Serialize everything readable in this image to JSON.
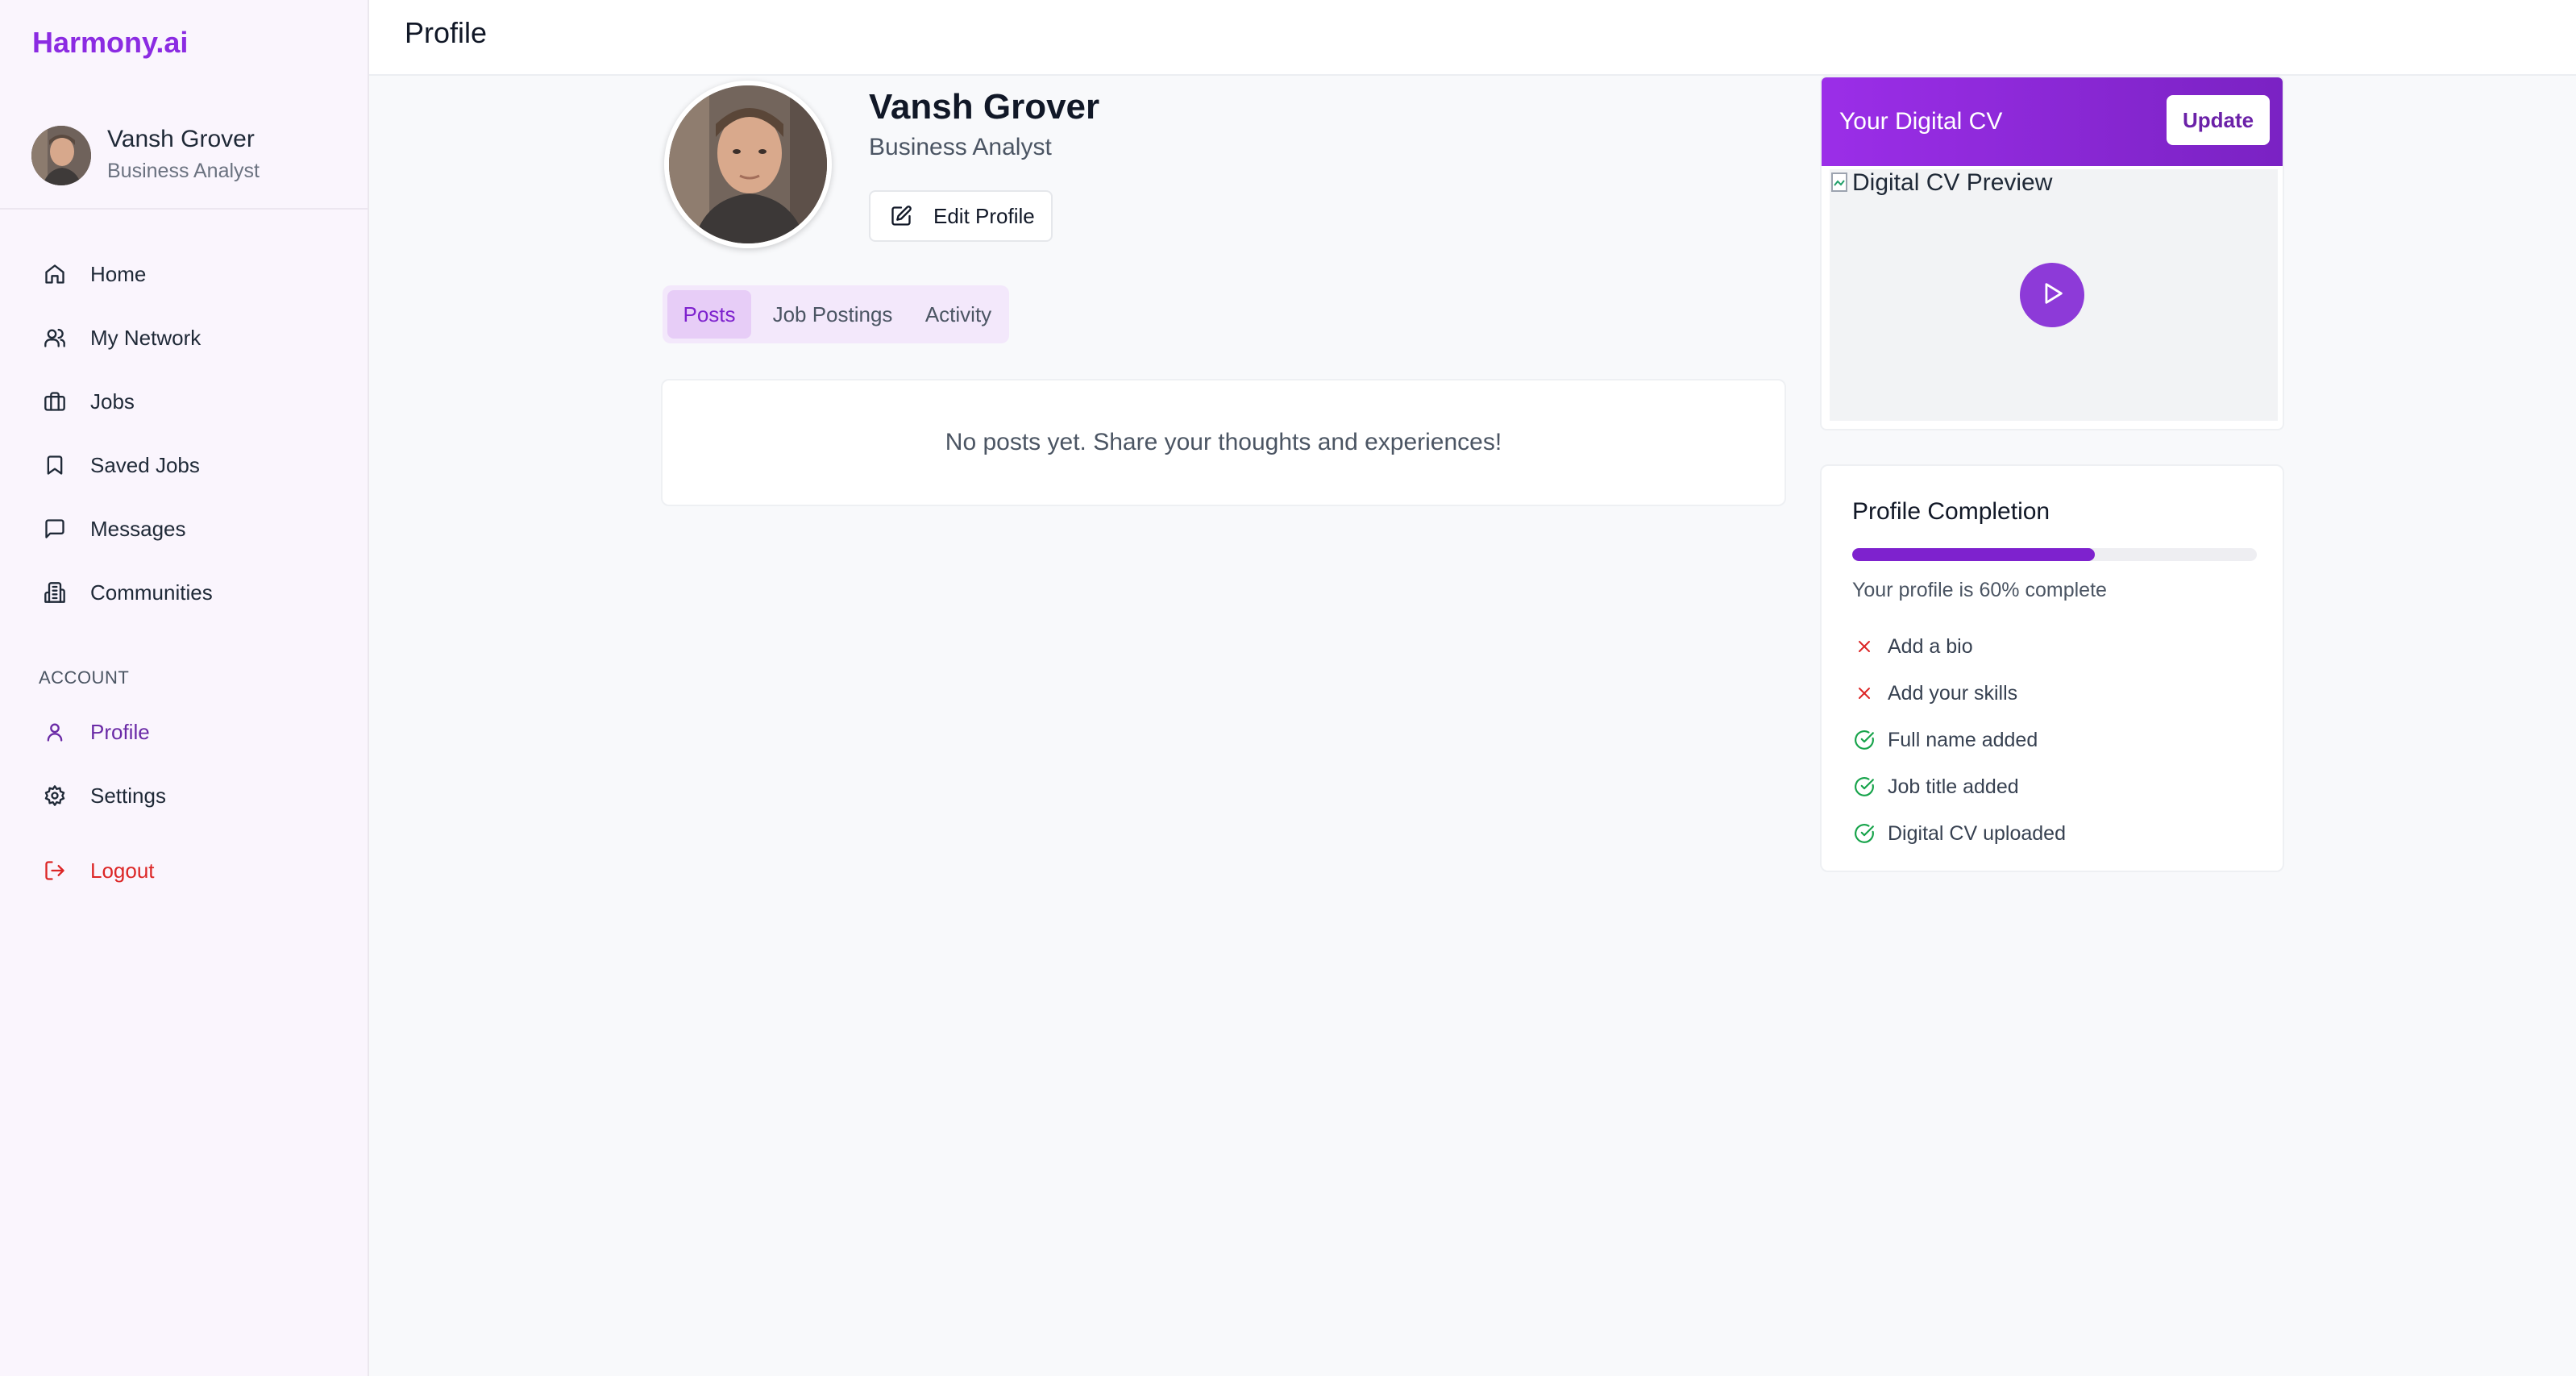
{
  "app": {
    "brand": "Harmony.ai",
    "accent": "#8b2be2"
  },
  "user": {
    "name": "Vansh Grover",
    "title": "Business Analyst"
  },
  "sidebar": {
    "items": [
      {
        "label": "Home",
        "icon": "home-icon"
      },
      {
        "label": "My Network",
        "icon": "users-icon"
      },
      {
        "label": "Jobs",
        "icon": "briefcase-icon"
      },
      {
        "label": "Saved Jobs",
        "icon": "bookmark-icon"
      },
      {
        "label": "Messages",
        "icon": "message-icon"
      },
      {
        "label": "Communities",
        "icon": "building-icon"
      }
    ],
    "section_label": "ACCOUNT",
    "account_items": [
      {
        "label": "Profile",
        "icon": "user-icon",
        "active": true
      },
      {
        "label": "Settings",
        "icon": "gear-icon"
      }
    ],
    "logout_label": "Logout"
  },
  "header": {
    "title": "Profile"
  },
  "profile": {
    "name": "Vansh Grover",
    "title": "Business Analyst",
    "edit_label": "Edit Profile"
  },
  "tabs": [
    {
      "label": "Posts",
      "active": true
    },
    {
      "label": "Job Postings"
    },
    {
      "label": "Activity"
    }
  ],
  "posts": {
    "empty_text": "No posts yet. Share your thoughts and experiences!"
  },
  "cv": {
    "title": "Your Digital CV",
    "update_label": "Update",
    "preview_alt": "Digital CV Preview"
  },
  "completion": {
    "title": "Profile Completion",
    "percent": 60,
    "status_text": "Your profile is 60% complete",
    "items": [
      {
        "label": "Add a bio",
        "done": false
      },
      {
        "label": "Add your skills",
        "done": false
      },
      {
        "label": "Full name added",
        "done": true
      },
      {
        "label": "Job title added",
        "done": true
      },
      {
        "label": "Digital CV uploaded",
        "done": true
      }
    ]
  }
}
